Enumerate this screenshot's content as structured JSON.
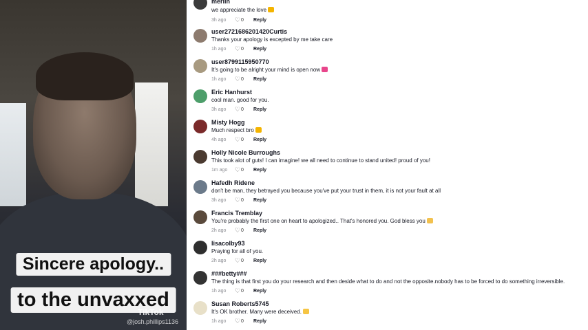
{
  "video": {
    "caption_line1": "Sincere apology..",
    "caption_line2": "to the unvaxxed",
    "watermark": "TikTok",
    "watermark_user": "@josh.phillips1136"
  },
  "comments": [
    {
      "name": "merlin",
      "text": "we appreciate the love",
      "time": "3h ago",
      "likes": "0",
      "reply": "Reply",
      "emoji": "smiling-face-hearts",
      "avatar_color": "#3b3b3b"
    },
    {
      "name": "user2721686201420Curtis",
      "text": "Thanks your apology is excepted by me take care",
      "time": "1h ago",
      "likes": "0",
      "reply": "Reply",
      "avatar_color": "#8d7b6e"
    },
    {
      "name": "user8799115950770",
      "text": "It's going to be alright your mind is open now",
      "time": "1h ago",
      "likes": "0",
      "reply": "Reply",
      "emoji": "sparkling-heart",
      "avatar_color": "#a89a80"
    },
    {
      "name": "Eric Hanhurst",
      "text": "cool man. good for you.",
      "time": "3h ago",
      "likes": "0",
      "reply": "Reply",
      "avatar_color": "#4d9e6a"
    },
    {
      "name": "Misty Hogg",
      "text": "Much respect bro",
      "time": "4h ago",
      "likes": "0",
      "reply": "Reply",
      "emoji": "smiling-face-hearts",
      "avatar_color": "#7a2a2a"
    },
    {
      "name": "Holly Nicole Burroughs",
      "text": "This took alot of guts! I can imagine! we all need to continue to stand united! proud of you!",
      "time": "1m ago",
      "likes": "0",
      "reply": "Reply",
      "avatar_color": "#4a3a30"
    },
    {
      "name": "Hafedh Ridene",
      "text": "don't be man, they betrayed you because you've put your trust in them, it is not your fault at all",
      "time": "3h ago",
      "likes": "0",
      "reply": "Reply",
      "avatar_color": "#6b7a8a"
    },
    {
      "name": "Francis Tremblay",
      "text": "You're probably the first one on heart to apologized.. That's honored you. God bless you",
      "time": "2h ago",
      "likes": "0",
      "reply": "Reply",
      "emoji": "victory-hand",
      "avatar_color": "#5a4a3c"
    },
    {
      "name": "lisacolby93",
      "text": "Praying for all of you.",
      "time": "2h ago",
      "likes": "0",
      "reply": "Reply",
      "avatar_color": "#2e2e2e"
    },
    {
      "name": "###betty###",
      "text": "The thing is that first you do your research and then deside what to do and not the opposite.nobody has to be forced to do something irreversible.",
      "time": "1h ago",
      "likes": "0",
      "reply": "Reply",
      "avatar_color": "#333333"
    },
    {
      "name": "Susan Roberts5745",
      "text": "It's OK brother. Many were deceived.",
      "time": "1h ago",
      "likes": "0",
      "reply": "Reply",
      "emoji": "raising-hands",
      "avatar_color": "#e8e0c8"
    }
  ],
  "colors": {
    "heart_icon": "#555555",
    "emoji_smiling": "#f4b400",
    "emoji_sparkling": "#e8458b",
    "emoji_victory": "#f2c14e",
    "emoji_raising": "#f6c544"
  }
}
